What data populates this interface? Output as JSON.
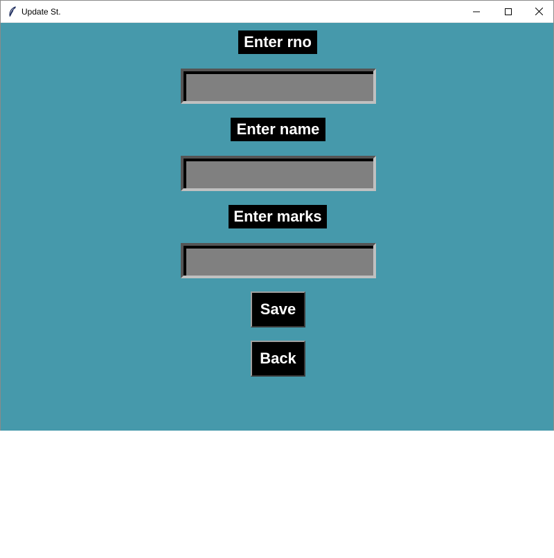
{
  "window": {
    "title": "Update St.",
    "background_color": "#4699ab",
    "controls": {
      "minimize_icon": "minimize-icon",
      "maximize_icon": "maximize-icon",
      "close_icon": "close-icon"
    }
  },
  "form": {
    "rno_label": "Enter rno",
    "rno_value": "",
    "name_label": "Enter name",
    "name_value": "",
    "marks_label": "Enter marks",
    "marks_value": "",
    "save_label": "Save",
    "back_label": "Back",
    "label_bg_color": "#000000",
    "label_text_color": "#ffffff",
    "entry_bg_color": "#808080"
  }
}
